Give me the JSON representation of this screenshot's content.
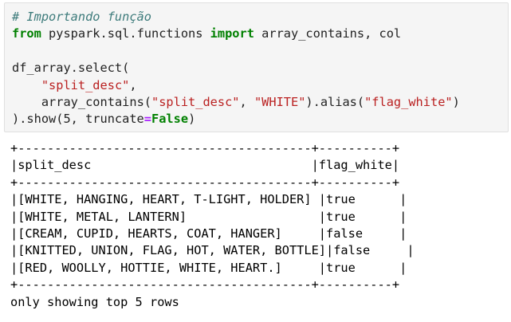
{
  "code": {
    "comment": "# Importando função",
    "import_from_keyword": "from",
    "import_module": " pyspark.sql.functions ",
    "import_keyword": "import",
    "import_names": " array_contains, col",
    "line_select": "df_array.select(",
    "indent": "    ",
    "split_desc_literal": "\"split_desc\"",
    "comma": ",",
    "array_contains_open": "array_contains(",
    "array_contains_arg_sep": ", ",
    "white_literal": "\"WHITE\"",
    "alias_call_open": ").alias(",
    "flag_white_literal": "\"flag_white\"",
    "alias_close": ")",
    "show_prefix": ").show(5, truncate",
    "equals": "=",
    "false_keyword": "False",
    "show_suffix": ")"
  },
  "output": {
    "border_top": "+----------------------------------------+----------+",
    "header_row": "|split_desc                              |flag_white|",
    "border_mid": "+----------------------------------------+----------+",
    "rows": [
      "|[WHITE, HANGING, HEART, T-LIGHT, HOLDER] |true      |",
      "|[WHITE, METAL, LANTERN]                  |true      |",
      "|[CREAM, CUPID, HEARTS, COAT, HANGER]     |false     |",
      "|[KNITTED, UNION, FLAG, HOT, WATER, BOTTLE]|false     |",
      "|[RED, WOOLLY, HOTTIE, WHITE, HEART.]     |true      |"
    ],
    "border_bottom": "+----------------------------------------+----------+",
    "footer": "only showing top 5 rows"
  }
}
